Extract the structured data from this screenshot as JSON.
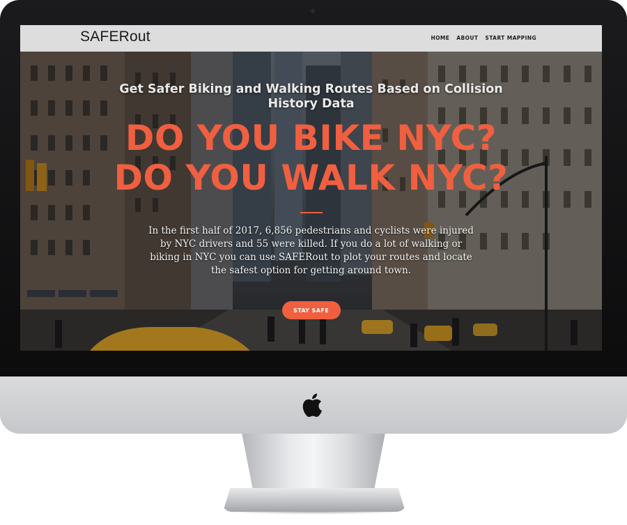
{
  "navbar": {
    "brand": "SAFERout",
    "links": [
      "HOME",
      "ABOUT",
      "START MAPPING"
    ]
  },
  "hero": {
    "subheadline": "Get Safer Biking and Walking Routes Based on Collision History Data",
    "headline_line1": "DO YOU BIKE NYC?",
    "headline_line2": "DO YOU WALK NYC?",
    "intro": "In the first half of 2017, 6,856 pedestrians and cyclists were injured by NYC drivers and 55 were killed. If you do a lot of walking or biking in NYC you can use SAFERout to plot your routes and locate the safest option for getting around town.",
    "cta_label": "STAY SAFE"
  },
  "colors": {
    "accent": "#f05f40",
    "navbar_bg": "#dddddd"
  }
}
